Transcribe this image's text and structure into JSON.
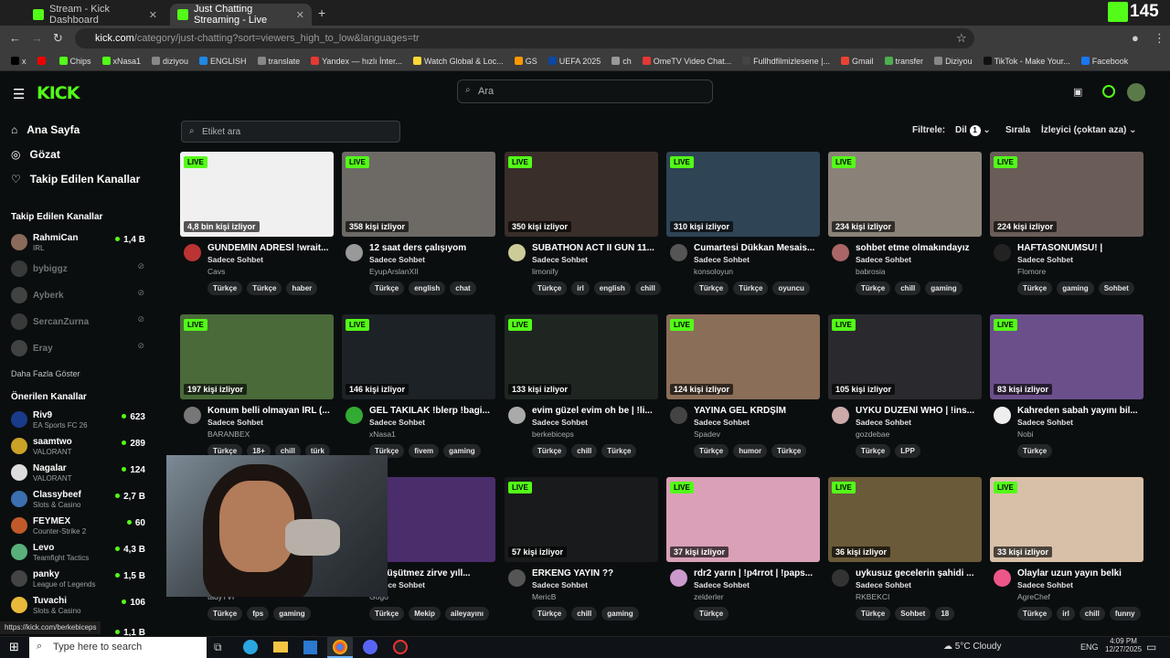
{
  "browser": {
    "tabs": [
      {
        "label": "Stream - Kick Dashboard"
      },
      {
        "label": "Just Chatting Streaming - Live"
      }
    ],
    "url_host": "kick.com",
    "url_path": "/category/just-chatting?sort=viewers_high_to_low&languages=tr",
    "badge": "145",
    "bookmarks": [
      {
        "label": "x",
        "color": "#000"
      },
      {
        "label": "",
        "color": "#e00"
      },
      {
        "label": "Chips",
        "color": "#53fc18"
      },
      {
        "label": "xNasa1",
        "color": "#53fc18"
      },
      {
        "label": "diziyou",
        "color": "#888"
      },
      {
        "label": "ENGLISH",
        "color": "#1e88e5"
      },
      {
        "label": "translate",
        "color": "#888"
      },
      {
        "label": "Yandex — hızlı İnter...",
        "color": "#e53935"
      },
      {
        "label": "Watch Global & Loc...",
        "color": "#fdd835"
      },
      {
        "label": "GS",
        "color": "#ff9800"
      },
      {
        "label": "UEFA 2025",
        "color": "#0d47a1"
      },
      {
        "label": "ch",
        "color": "#999"
      },
      {
        "label": "OmeTV Video Chat...",
        "color": "#e53935"
      },
      {
        "label": "Fullhdfilmizlesene |...",
        "color": "#444"
      },
      {
        "label": "Gmail",
        "color": "#ea4335"
      },
      {
        "label": "transfer",
        "color": "#4caf50"
      },
      {
        "label": "Diziyou",
        "color": "#888"
      },
      {
        "label": "TikTok - Make Your...",
        "color": "#111"
      },
      {
        "label": "Facebook",
        "color": "#1877f2"
      }
    ]
  },
  "header": {
    "logo": "KICK",
    "search_placeholder": "Ara"
  },
  "sidebar": {
    "nav": [
      {
        "label": "Ana Sayfa",
        "icon": "home-icon"
      },
      {
        "label": "Gözat",
        "icon": "compass-icon"
      },
      {
        "label": "Takip Edilen Kanallar",
        "icon": "heart-icon"
      }
    ],
    "followed_title": "Takip Edilen Kanallar",
    "followed": [
      {
        "name": "RahmiCan",
        "game": "IRL",
        "viewers": "1,4 B",
        "color": "#8a6a5a"
      },
      {
        "name": "bybiggz",
        "color": "#666"
      },
      {
        "name": "Ayberk",
        "color": "#777"
      },
      {
        "name": "SercanZurna",
        "color": "#666"
      },
      {
        "name": "Eray",
        "color": "#777"
      }
    ],
    "show_more": "Daha Fazla Göster",
    "recommended_title": "Önerilen Kanallar",
    "recommended": [
      {
        "name": "Riv9",
        "game": "EA Sports FC 26",
        "viewers": "623",
        "color": "#1a3a8a"
      },
      {
        "name": "saamtwo",
        "game": "VALORANT",
        "viewers": "289",
        "color": "#c9a227"
      },
      {
        "name": "Nagalar",
        "game": "VALORANT",
        "viewers": "124",
        "color": "#ddd"
      },
      {
        "name": "Classybeef",
        "game": "Slots & Casino",
        "viewers": "2,7 B",
        "color": "#3b6fb0"
      },
      {
        "name": "FEYMEX",
        "game": "Counter-Strike 2",
        "viewers": "60",
        "color": "#c05a2a"
      },
      {
        "name": "Levo",
        "game": "Teamfight Tactics",
        "viewers": "4,3 B",
        "color": "#5ab07a"
      },
      {
        "name": "panky",
        "game": "League of Legends",
        "viewers": "1,5 B",
        "color": "#444"
      },
      {
        "name": "Tuvachi",
        "game": "Slots & Casino",
        "viewers": "106",
        "color": "#e8b93a"
      }
    ],
    "partial_viewers": "1,1 B"
  },
  "toolbar": {
    "tag_search_placeholder": "Etiket ara",
    "filter_label": "Filtrele:",
    "lang_label": "Dil",
    "lang_count": "1",
    "sort_label": "Sırala",
    "sort_value": "İzleyici (çoktan aza)"
  },
  "live_label": "LIVE",
  "streams": [
    {
      "viewers": "4,8 bin kişi izliyor",
      "title": "GÜNDEMİN ADRESİ !wrait...",
      "category": "Sadece Sohbet",
      "user": "Cavs",
      "tags": [
        "Türkçe",
        "Türkçe",
        "haber"
      ],
      "bg": "#f0f0f0",
      "av": "#b33"
    },
    {
      "viewers": "358 kişi izliyor",
      "title": "12 saat ders çalışıyom",
      "category": "Sadece Sohbet",
      "user": "EyupArslanXII",
      "tags": [
        "Türkçe",
        "english",
        "chat"
      ],
      "bg": "#6d6a66",
      "av": "#999"
    },
    {
      "viewers": "350 kişi izliyor",
      "title": "SUBATHON ACT II GÜN 11...",
      "category": "Sadece Sohbet",
      "user": "limonify",
      "tags": [
        "Türkçe",
        "irl",
        "english",
        "chill"
      ],
      "bg": "#3a2e2a",
      "av": "#cc9"
    },
    {
      "viewers": "310 kişi izliyor",
      "title": "Cumartesi Dükkan Mesais...",
      "category": "Sadece Sohbet",
      "user": "konsoloyun",
      "tags": [
        "Türkçe",
        "Türkçe",
        "oyuncu"
      ],
      "bg": "#2f4455",
      "av": "#555"
    },
    {
      "viewers": "234 kişi izliyor",
      "title": "sohbet etme olmakındayız",
      "category": "Sadece Sohbet",
      "user": "babrosia",
      "tags": [
        "Türkçe",
        "chill",
        "gaming"
      ],
      "bg": "#8a8278",
      "av": "#a66"
    },
    {
      "viewers": "224 kişi izliyor",
      "title": "HAFTASONUMSU! |",
      "category": "Sadece Sohbet",
      "user": "Flomore",
      "tags": [
        "Türkçe",
        "gaming",
        "Sohbet"
      ],
      "bg": "#6a5d58",
      "av": "#222"
    },
    {
      "viewers": "197 kişi izliyor",
      "title": "Konum belli olmayan İRL (...",
      "category": "Sadece Sohbet",
      "user": "BARANBEX",
      "tags": [
        "Türkçe",
        "18+",
        "chill",
        "türk"
      ],
      "bg": "#4a6a3a",
      "av": "#777"
    },
    {
      "viewers": "146 kişi izliyor",
      "title": "GEL TAKILAK !blerp !bagi...",
      "category": "Sadece Sohbet",
      "user": "xNasa1",
      "tags": [
        "Türkçe",
        "fivem",
        "gaming"
      ],
      "bg": "#1d2226",
      "av": "#3a3"
    },
    {
      "viewers": "133 kişi izliyor",
      "title": "evim güzel evim oh be | !li...",
      "category": "Sadece Sohbet",
      "user": "berkebiceps",
      "tags": [
        "Türkçe",
        "chill",
        "Türkçe"
      ],
      "bg": "#1f2622",
      "av": "#aaa"
    },
    {
      "viewers": "124 kişi izliyor",
      "title": "YAYINA GEL KRDŞİM",
      "category": "Sadece Sohbet",
      "user": "Spadev",
      "tags": [
        "Türkçe",
        "humor",
        "Türkçe"
      ],
      "bg": "#8a6e58",
      "av": "#444"
    },
    {
      "viewers": "105 kişi izliyor",
      "title": "UYKU DÜZENİ WHO | !ins...",
      "category": "Sadece Sohbet",
      "user": "gozdebae",
      "tags": [
        "Türkçe",
        "LPP"
      ],
      "bg": "#2a2a2e",
      "av": "#caa"
    },
    {
      "viewers": "83 kişi izliyor",
      "title": "Kahreden sabah yayını bil...",
      "category": "Sadece Sohbet",
      "user": "Nobi",
      "tags": [
        "Türkçe"
      ],
      "bg": "#6b4f8a",
      "av": "#eee"
    },
    {
      "viewers": "",
      "title": "",
      "category": "",
      "user": "tadyTVI",
      "tags": [
        "Türkçe",
        "fps",
        "gaming"
      ],
      "bg": "#333",
      "av": "#555"
    },
    {
      "viewers": "",
      "title": "bizi üşütmez zirve yıll...",
      "category": "Sadece Sohbet",
      "user": "Gogo",
      "tags": [
        "Türkçe",
        "Mekip",
        "aileyayını"
      ],
      "bg": "#4a2d6a",
      "av": "#555"
    },
    {
      "viewers": "57 kişi izliyor",
      "title": "ERKENG YAYIN ??",
      "category": "Sadece Sohbet",
      "user": "MericB",
      "tags": [
        "Türkçe",
        "chill",
        "gaming"
      ],
      "bg": "#181a1c",
      "av": "#555"
    },
    {
      "viewers": "37 kişi izliyor",
      "title": "rdr2 yarın | !p4rrot | !paps...",
      "category": "Sadece Sohbet",
      "user": "zelderler",
      "tags": [
        "Türkçe"
      ],
      "bg": "#d9a0b8",
      "av": "#c9c"
    },
    {
      "viewers": "36 kişi izliyor",
      "title": "uykusuz gecelerin şahidi ...",
      "category": "Sadece Sohbet",
      "user": "RKBEKCI",
      "tags": [
        "Türkçe",
        "Sohbet",
        "18"
      ],
      "bg": "#6a5a3a",
      "av": "#333"
    },
    {
      "viewers": "33 kişi izliyor",
      "title": "Olaylar uzun yayın belki",
      "category": "Sadece Sohbet",
      "user": "AgreChef",
      "tags": [
        "Türkçe",
        "irl",
        "chill",
        "funny"
      ],
      "bg": "#d8bfa8",
      "av": "#e58"
    }
  ],
  "popup": {
    "label": "video popup"
  },
  "status_url": "https://kick.com/berkebiceps",
  "taskbar": {
    "search_placeholder": "Type here to search",
    "weather": "5°C  Cloudy",
    "lang": "ENG",
    "time": "4:09 PM",
    "date": "12/27/2025"
  }
}
